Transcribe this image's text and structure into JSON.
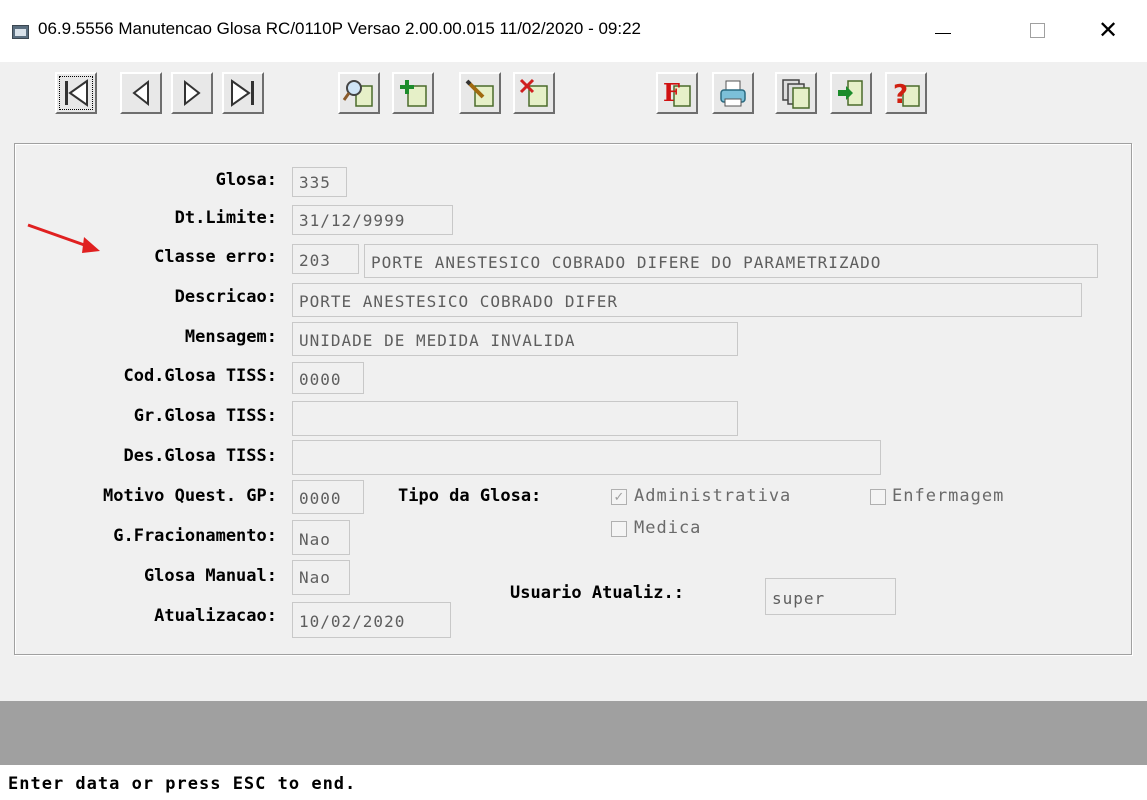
{
  "window": {
    "title": "06.9.5556 Manutencao  Glosa RC/0110P Versao 2.00.00.015 11/02/2020 - 09:22",
    "min_symbol": "—",
    "close_symbol": "✕"
  },
  "toolbar": {
    "buttons": [
      {
        "name": "first-record",
        "icon": "first-icon"
      },
      {
        "name": "previous-record",
        "icon": "previous-icon"
      },
      {
        "name": "next-record",
        "icon": "next-icon"
      },
      {
        "name": "last-record",
        "icon": "last-icon"
      },
      {
        "name": "search",
        "icon": "magnifier-icon"
      },
      {
        "name": "add",
        "icon": "add-icon"
      },
      {
        "name": "edit",
        "icon": "edit-icon"
      },
      {
        "name": "delete",
        "icon": "delete-icon"
      },
      {
        "name": "filter",
        "icon": "filter-icon",
        "glyph": "F"
      },
      {
        "name": "print",
        "icon": "printer-icon"
      },
      {
        "name": "copy",
        "icon": "copy-icon"
      },
      {
        "name": "exit",
        "icon": "exit-icon"
      },
      {
        "name": "help",
        "icon": "help-icon",
        "glyph": "?"
      }
    ]
  },
  "form": {
    "glosa": {
      "label": "Glosa:",
      "value": "335"
    },
    "dt_limite": {
      "label": "Dt.Limite:",
      "value": "31/12/9999"
    },
    "classe_erro": {
      "label": "Classe erro:",
      "code": "203",
      "description": "PORTE ANESTESICO COBRADO DIFERE DO PARAMETRIZADO"
    },
    "descricao": {
      "label": "Descricao:",
      "value": "PORTE ANESTESICO COBRADO DIFER"
    },
    "mensagem": {
      "label": "Mensagem:",
      "value": "UNIDADE DE MEDIDA INVALIDA"
    },
    "cod_glosa_tiss": {
      "label": "Cod.Glosa TISS:",
      "value": "0000"
    },
    "gr_glosa_tiss": {
      "label": "Gr.Glosa TISS:",
      "value": ""
    },
    "des_glosa_tiss": {
      "label": "Des.Glosa TISS:",
      "value": ""
    },
    "motivo_quest_gp": {
      "label": "Motivo Quest. GP:",
      "value": "0000"
    },
    "tipo_glosa": {
      "label": "Tipo da Glosa:",
      "options": [
        {
          "label": "Administrativa",
          "checked": true
        },
        {
          "label": "Enfermagem",
          "checked": false
        },
        {
          "label": "Medica",
          "checked": false
        }
      ]
    },
    "g_fracionamento": {
      "label": "G.Fracionamento:",
      "value": "Nao"
    },
    "glosa_manual": {
      "label": "Glosa Manual:",
      "value": "Nao"
    },
    "usuario_atualiz": {
      "label": "Usuario Atualiz.:",
      "value": "super"
    },
    "atualizacao": {
      "label": "Atualizacao:",
      "value": "10/02/2020"
    }
  },
  "status": {
    "message": "Enter data or press ESC to end."
  },
  "colors": {
    "arrow": "#e02020",
    "panel_bg": "#f0f0f0",
    "gray_bar": "#a0a0a0"
  }
}
